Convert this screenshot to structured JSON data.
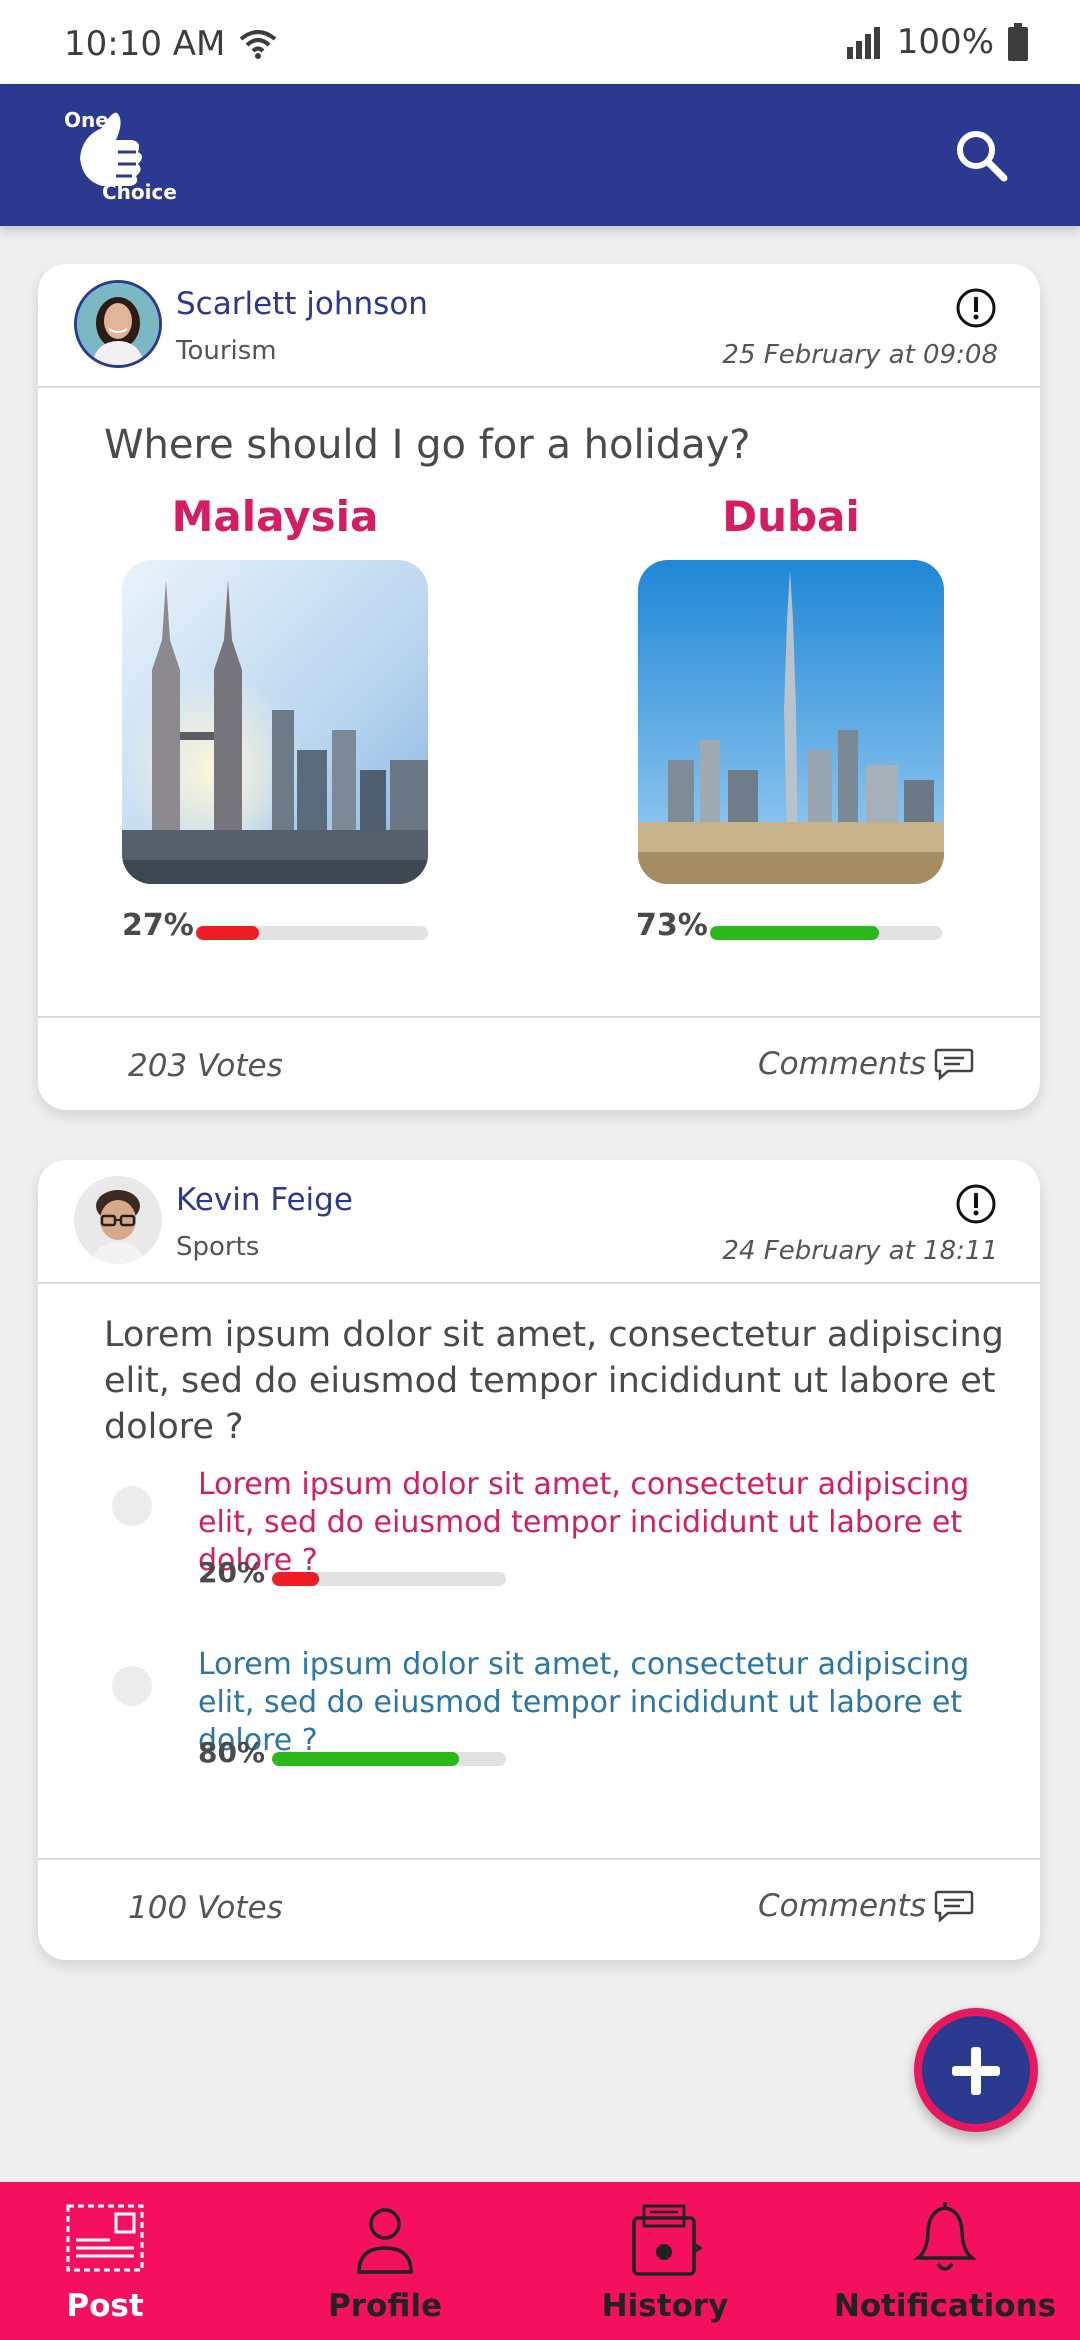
{
  "status_bar": {
    "time": "10:10 AM",
    "battery": "100%"
  },
  "app": {
    "logo_top": "One",
    "logo_bottom": "Choice",
    "search_icon": "search-icon"
  },
  "posts": [
    {
      "user": "Scarlett johnson",
      "category": "Tourism",
      "date": "25 February at 09:08",
      "question": "Where should I go for a holiday?",
      "options": [
        {
          "label": "Malaysia",
          "percent_text": "27%",
          "percent": 27
        },
        {
          "label": "Dubai",
          "percent_text": "73%",
          "percent": 73
        }
      ],
      "votes": "203 Votes",
      "comments": "Comments"
    },
    {
      "user": "Kevin Feige",
      "category": "Sports",
      "date": "24 February at 18:11",
      "question": "Lorem ipsum dolor sit amet, consectetur adipiscing elit, sed do eiusmod tempor incididunt ut labore et dolore ?",
      "options": [
        {
          "label": "Lorem ipsum dolor sit amet, consectetur adipiscing elit, sed do eiusmod tempor incididunt ut labore et dolore ?",
          "percent_text": "20%",
          "percent": 20
        },
        {
          "label": "Lorem ipsum dolor sit amet, consectetur adipiscing elit, sed do eiusmod tempor incididunt ut labore et dolore ?",
          "percent_text": "80%",
          "percent": 80
        }
      ],
      "votes": "100 Votes",
      "comments": "Comments"
    }
  ],
  "nav": {
    "items": [
      {
        "label": "Post",
        "icon": "post-icon",
        "active": true
      },
      {
        "label": "Profile",
        "icon": "profile-icon",
        "active": false
      },
      {
        "label": "History",
        "icon": "history-icon",
        "active": false
      },
      {
        "label": "Notifications",
        "icon": "bell-icon",
        "active": false
      }
    ]
  },
  "colors": {
    "primary": "#2c3990",
    "accent": "#f4105f",
    "option_pink": "#d61d63",
    "bar_red": "#ee1c24",
    "bar_green": "#2bb81b"
  }
}
